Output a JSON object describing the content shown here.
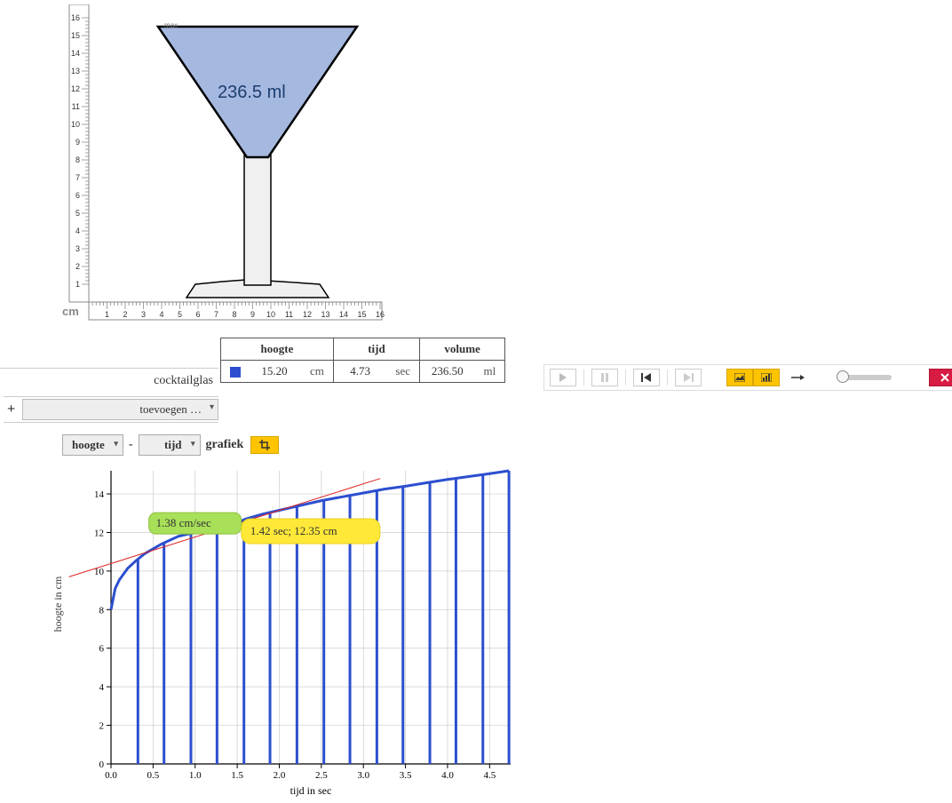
{
  "glass_area": {
    "ruler_unit": "cm",
    "max_label": "max",
    "volume_display": "236.5 ml",
    "y_ticks": [
      "1",
      "2",
      "3",
      "4",
      "5",
      "6",
      "7",
      "8",
      "9",
      "10",
      "11",
      "12",
      "13",
      "14",
      "15",
      "16"
    ],
    "x_ticks": [
      "1",
      "2",
      "3",
      "4",
      "5",
      "6",
      "7",
      "8",
      "9",
      "10",
      "11",
      "12",
      "13",
      "14",
      "15",
      "16"
    ]
  },
  "table": {
    "headers": {
      "hoogte": "hoogte",
      "tijd": "tijd",
      "volume": "volume"
    },
    "row_label": "cocktailglas",
    "hoogte_val": "15.20",
    "hoogte_unit": "cm",
    "tijd_val": "4.73",
    "tijd_unit": "sec",
    "volume_val": "236.50",
    "volume_unit": "ml",
    "swatch_color": "#2c4fcf",
    "add_placeholder": "toevoegen …"
  },
  "graph_controls": {
    "yaxis": "hoogte",
    "dash": "-",
    "xaxis": "tijd",
    "label": "grafiek"
  },
  "chart_data": {
    "type": "line",
    "title": "",
    "xlabel": "tijd in sec",
    "ylabel": "hoogte in cm",
    "xlim": [
      0.0,
      4.75
    ],
    "ylim": [
      0,
      15.2
    ],
    "x_ticks": [
      "0.0",
      "0.5",
      "1.0",
      "1.5",
      "2.0",
      "2.5",
      "3.0",
      "3.5",
      "4.0",
      "4.5"
    ],
    "y_ticks": [
      "0",
      "2",
      "4",
      "6",
      "8",
      "10",
      "12",
      "14"
    ],
    "series": [
      {
        "name": "cocktailglas",
        "color": "#2c4fcf",
        "points": [
          [
            0.0,
            8.0
          ],
          [
            0.05,
            9.1
          ],
          [
            0.1,
            9.55
          ],
          [
            0.2,
            10.15
          ],
          [
            0.3,
            10.55
          ],
          [
            0.4,
            10.9
          ],
          [
            0.5,
            11.15
          ],
          [
            0.6,
            11.4
          ],
          [
            0.8,
            11.8
          ],
          [
            1.0,
            12.0
          ],
          [
            1.2,
            12.2
          ],
          [
            1.42,
            12.35
          ],
          [
            1.6,
            12.7
          ],
          [
            1.8,
            12.95
          ],
          [
            2.0,
            13.15
          ],
          [
            2.25,
            13.4
          ],
          [
            2.5,
            13.65
          ],
          [
            2.75,
            13.85
          ],
          [
            3.0,
            14.05
          ],
          [
            3.25,
            14.25
          ],
          [
            3.5,
            14.4
          ],
          [
            3.75,
            14.58
          ],
          [
            4.0,
            14.75
          ],
          [
            4.25,
            14.9
          ],
          [
            4.5,
            15.05
          ],
          [
            4.73,
            15.2
          ]
        ]
      }
    ],
    "vertical_bars_x": [
      0.32,
      0.63,
      0.95,
      1.26,
      1.58,
      1.89,
      2.21,
      2.53,
      2.84,
      3.16,
      3.47,
      3.79,
      4.1,
      4.42,
      4.73
    ],
    "tangent": {
      "at_x": 1.42,
      "slope_label": "1.38 cm/sec",
      "point_label": "1.42 sec; 12.35 cm",
      "line_p1": [
        -0.5,
        9.7
      ],
      "line_p2": [
        3.2,
        14.8
      ]
    }
  }
}
